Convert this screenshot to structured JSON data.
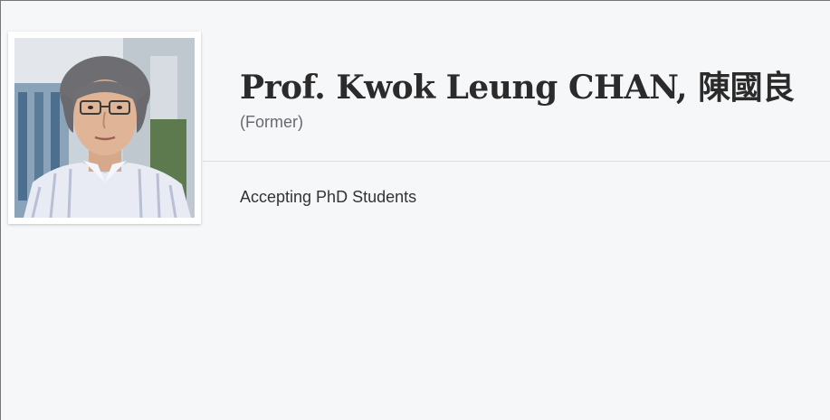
{
  "profile": {
    "name": "Prof. Kwok Leung CHAN, 陳國良",
    "status": "(Former)",
    "accepting_label": "Accepting PhD Students",
    "photo_description": "profile-photo"
  },
  "colors": {
    "background": "#f6f7f9",
    "name_text": "#2b2b2b",
    "status_text": "#666a70",
    "divider": "#dadde2"
  }
}
